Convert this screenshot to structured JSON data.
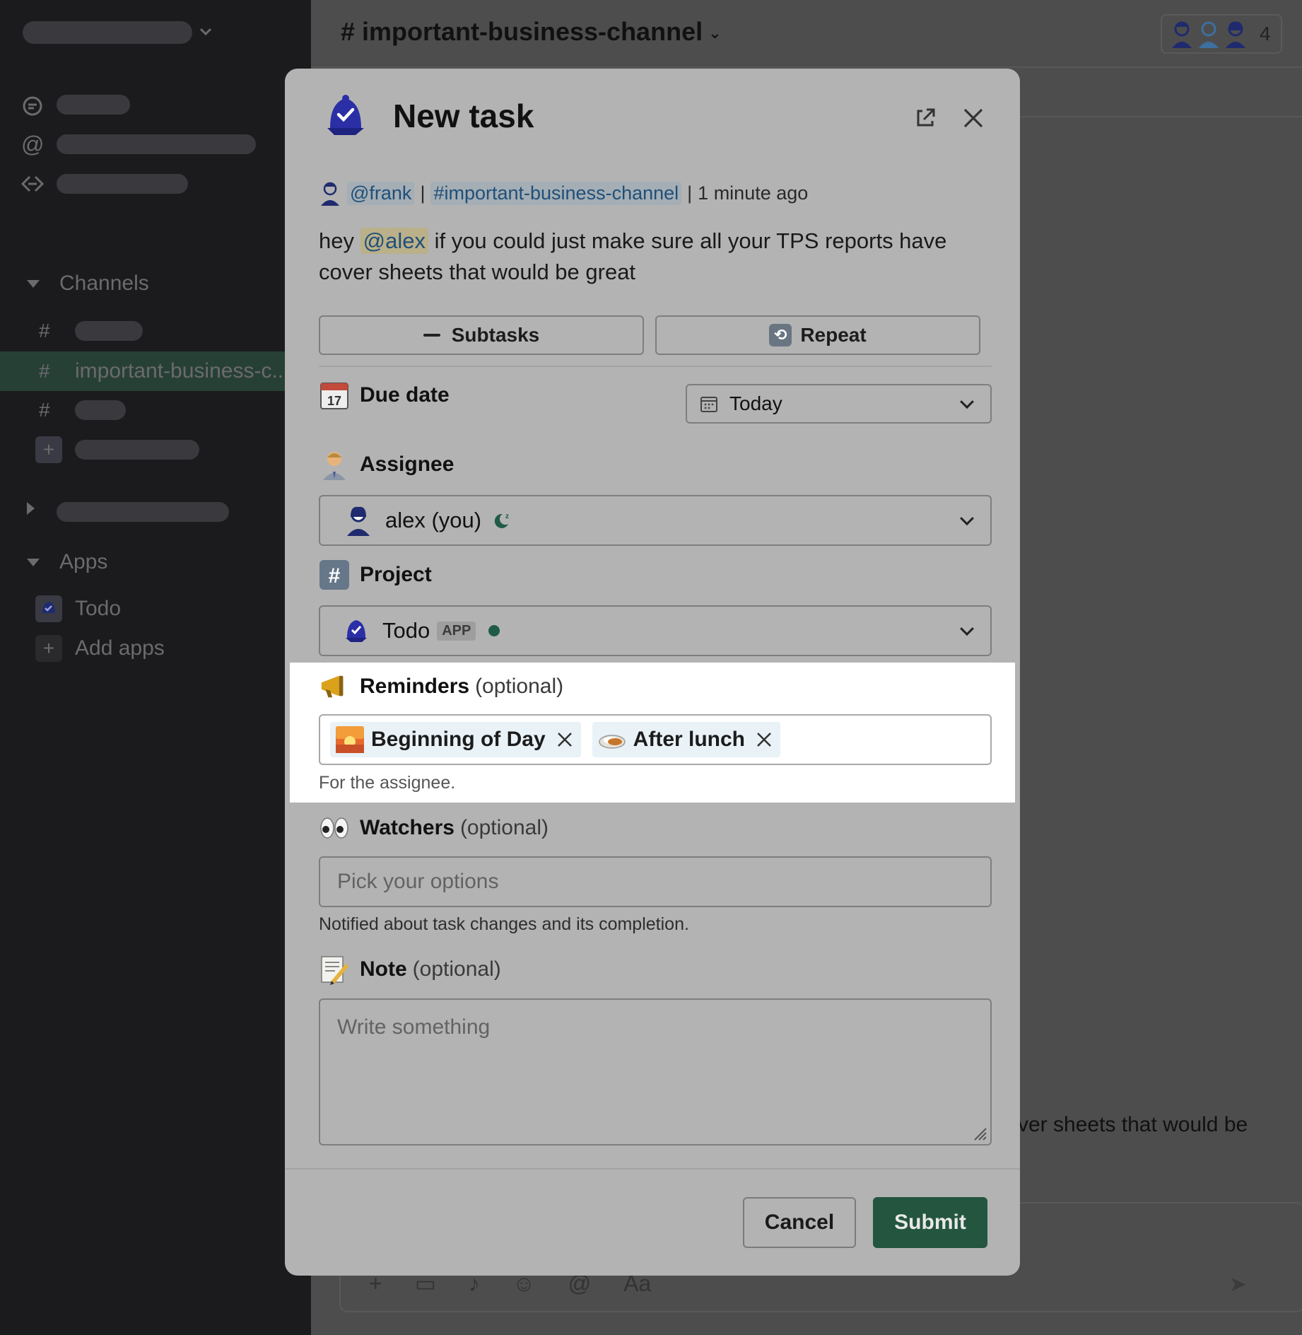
{
  "channel": {
    "name": "# important-business-channel",
    "member_count": "4"
  },
  "sidebar": {
    "channels_header": "Channels",
    "active_channel": "important-business-c...",
    "apps_header": "Apps",
    "apps": [
      {
        "label": "Todo",
        "icon": "todo-bell-icon"
      },
      {
        "label": "Add apps",
        "icon": "plus-icon"
      }
    ]
  },
  "background": {
    "message_fragment": "ver sheets that would be",
    "composer_tools": [
      "+",
      "Aa"
    ]
  },
  "modal": {
    "title": "New task",
    "meta": {
      "author": "@frank",
      "channel": "#important-business-channel",
      "separator": "|",
      "time": "1 minute ago"
    },
    "message": {
      "prefix": "hey",
      "mention": "@alex",
      "rest": "if you could just make sure all your TPS reports have cover sheets that would be great"
    },
    "buttons": {
      "subtasks": "Subtasks",
      "repeat": "Repeat",
      "cancel": "Cancel",
      "submit": "Submit"
    },
    "due_date": {
      "label": "Due date",
      "value": "Today",
      "icon": "calendar-17-icon"
    },
    "assignee": {
      "label": "Assignee",
      "value": "alex (you)",
      "icon": "office-worker-icon"
    },
    "project": {
      "label": "Project",
      "value": "Todo",
      "badge": "APP",
      "icon": "hash-icon"
    },
    "reminders": {
      "label": "Reminders",
      "optional": "(optional)",
      "chips": [
        {
          "label": "Beginning of Day",
          "icon": "sunrise-icon"
        },
        {
          "label": "After lunch",
          "icon": "curry-bowl-icon"
        }
      ],
      "hint": "For the assignee."
    },
    "watchers": {
      "label": "Watchers",
      "optional": "(optional)",
      "placeholder": "Pick your options",
      "hint": "Notified about task changes and its completion."
    },
    "note": {
      "label": "Note",
      "optional": "(optional)",
      "placeholder": "Write something"
    }
  },
  "colors": {
    "sidebar_bg": "#1b1a1c",
    "active_channel_bg": "#274036",
    "overlay_modal_bg": "#b3b3b3",
    "highlight_bg": "#ffffff",
    "submit_bg": "#23553f",
    "mention_text": "#1f4f7a"
  }
}
